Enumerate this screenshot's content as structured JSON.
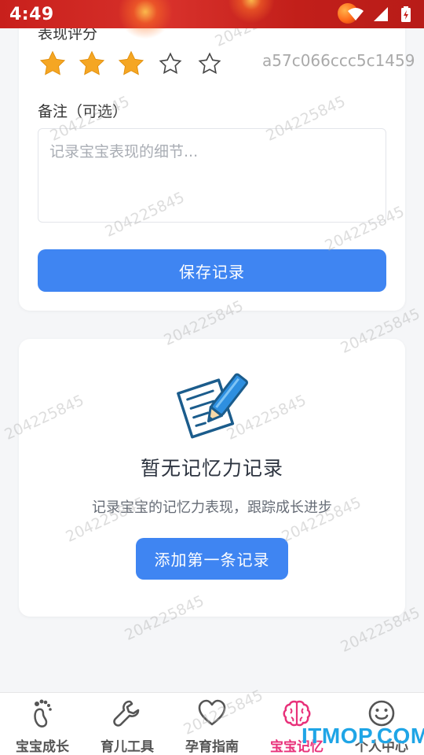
{
  "status_bar": {
    "time": "4:49",
    "icons": [
      "wifi-icon",
      "signal-icon",
      "battery-icon"
    ]
  },
  "rating": {
    "label": "表现评分",
    "value": 3,
    "max": 5,
    "hash_text": "a57c066ccc5c1459"
  },
  "notes": {
    "label": "备注（可选）",
    "placeholder": "记录宝宝表现的细节...",
    "value": ""
  },
  "save_button": {
    "label": "保存记录"
  },
  "empty_state": {
    "icon": "writing-note-icon",
    "title": "暂无记忆力记录",
    "description": "记录宝宝的记忆力表现，跟踪成长进步",
    "add_button_label": "添加第一条记录"
  },
  "watermark_text": "204225845",
  "bottom_nav": {
    "items": [
      {
        "label": "宝宝成长",
        "icon": "footprint-icon",
        "active": false
      },
      {
        "label": "育儿工具",
        "icon": "wrench-icon",
        "active": false
      },
      {
        "label": "孕育指南",
        "icon": "heart-icon",
        "active": false
      },
      {
        "label": "宝宝记忆",
        "icon": "brain-icon",
        "active": true
      },
      {
        "label": "个人中心",
        "icon": "smiley-icon",
        "active": false
      }
    ]
  },
  "overlay_logo": "ITMOP.COM",
  "colors": {
    "primary": "#3f85f2",
    "active_tab": "#e8317a",
    "star": "#f5a623",
    "status_bar": "#c8201c"
  }
}
